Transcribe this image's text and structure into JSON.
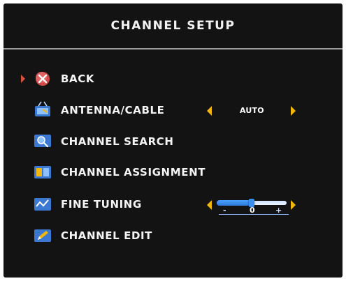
{
  "title": "CHANNEL SETUP",
  "menu": [
    {
      "label": "BACK",
      "icon": "back-icon"
    },
    {
      "label": "ANTENNA/CABLE",
      "icon": "antenna-icon"
    },
    {
      "label": "CHANNEL SEARCH",
      "icon": "search-icon"
    },
    {
      "label": "CHANNEL ASSIGNMENT",
      "icon": "assignment-icon"
    },
    {
      "label": "FINE TUNING",
      "icon": "tuning-icon"
    },
    {
      "label": "CHANNEL EDIT",
      "icon": "edit-icon"
    }
  ],
  "antenna_cable": {
    "value": "AUTO"
  },
  "fine_tuning": {
    "minus": "-",
    "value": "0",
    "plus": "+",
    "level": 0.5
  },
  "colors": {
    "background": "#131313",
    "text": "#f4f4f4",
    "divider": "#9a9a9a",
    "arrow_yellow": "#f2b70c",
    "cursor_red": "#d8513f",
    "slider_blue": "#3b8ff0"
  }
}
